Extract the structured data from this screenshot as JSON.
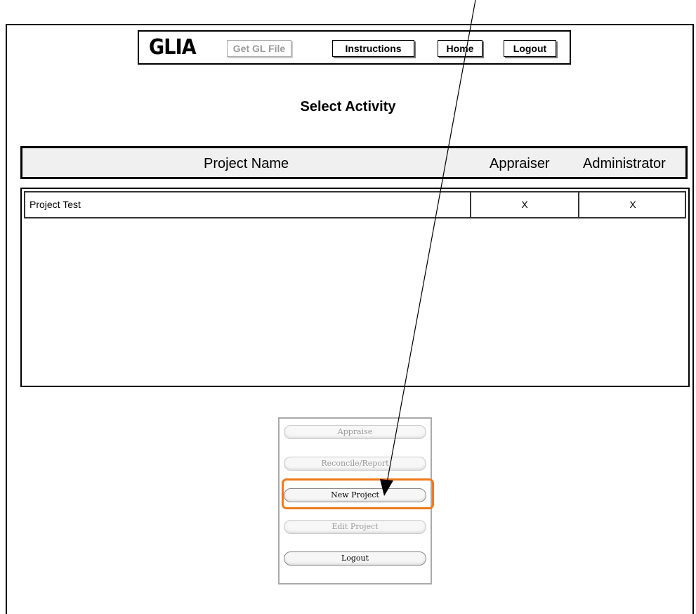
{
  "logo": "GLIA",
  "nav": {
    "get_gl_file": "Get GL File",
    "instructions": "Instructions",
    "home": "Home",
    "logout": "Logout"
  },
  "title": "Select Activity",
  "table": {
    "headers": [
      "Project Name",
      "Appraiser",
      "Administrator"
    ],
    "rows": [
      {
        "name": "Project Test",
        "appraiser": "X",
        "administrator": "X"
      }
    ]
  },
  "actions": {
    "appraise": "Appraise",
    "reconcile_report": "Reconcile/Report",
    "new_project": "New Project",
    "edit_project": "Edit Project",
    "logout": "Logout"
  },
  "colors": {
    "highlight": "#f07a1a",
    "disabled_text": "#999999"
  }
}
